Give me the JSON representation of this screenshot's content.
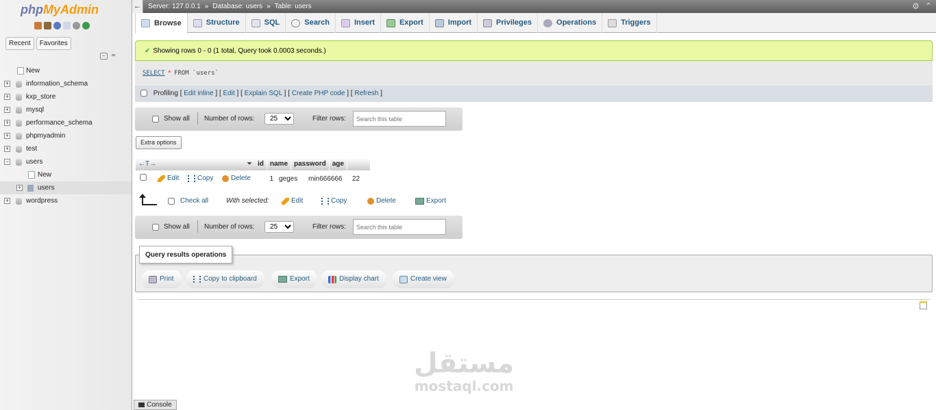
{
  "logo": {
    "php": "php",
    "myadmin": "MyAdmin"
  },
  "nav_tabs": {
    "recent": "Recent",
    "favorites": "Favorites"
  },
  "tree": [
    {
      "label": "New",
      "type": "new"
    },
    {
      "label": "information_schema",
      "type": "db"
    },
    {
      "label": "kxp_store",
      "type": "db"
    },
    {
      "label": "mysql",
      "type": "db"
    },
    {
      "label": "performance_schema",
      "type": "db"
    },
    {
      "label": "phpmyadmin",
      "type": "db"
    },
    {
      "label": "test",
      "type": "db"
    },
    {
      "label": "users",
      "type": "db-open"
    },
    {
      "label": "New",
      "type": "sub-new"
    },
    {
      "label": "users",
      "type": "sub-table"
    },
    {
      "label": "wordpress",
      "type": "db"
    }
  ],
  "breadcrumb": {
    "server": "Server: 127.0.0.1",
    "database": "Database: users",
    "table": "Table: users",
    "sep": "»"
  },
  "tabs": [
    "Browse",
    "Structure",
    "SQL",
    "Search",
    "Insert",
    "Export",
    "Import",
    "Privileges",
    "Operations",
    "Triggers"
  ],
  "success_message": "Showing rows 0 - 0 (1 total, Query took 0.0003 seconds.)",
  "sql": {
    "select": "SELECT",
    "star": "*",
    "rest": "FROM `users`"
  },
  "profiling": {
    "label": "Profiling",
    "edit_inline": "Edit inline",
    "edit": "Edit",
    "explain": "Explain SQL",
    "create_php": "Create PHP code",
    "refresh": "Refresh"
  },
  "nav_controls": {
    "show_all": "Show all",
    "number_of_rows": "Number of rows:",
    "rows_value": "25",
    "filter_rows": "Filter rows:",
    "filter_placeholder": "Search this table"
  },
  "extra_options": "Extra options",
  "table": {
    "arrows": "←T→",
    "columns": [
      "id",
      "name",
      "password",
      "age"
    ],
    "rows": [
      {
        "edit": "Edit",
        "copy": "Copy",
        "delete": "Delete",
        "cells": [
          "1",
          "geges",
          "min666666",
          "22"
        ]
      }
    ]
  },
  "with_selected": {
    "check_all": "Check all",
    "label": "With selected:",
    "edit": "Edit",
    "copy": "Copy",
    "delete": "Delete",
    "export": "Export"
  },
  "query_ops": {
    "legend": "Query results operations",
    "print": "Print",
    "copy_clipboard": "Copy to clipboard",
    "export": "Export",
    "display_chart": "Display chart",
    "create_view": "Create view"
  },
  "console": "Console",
  "watermark": {
    "arabic": "مستقل",
    "latin": "mostaql.com"
  }
}
